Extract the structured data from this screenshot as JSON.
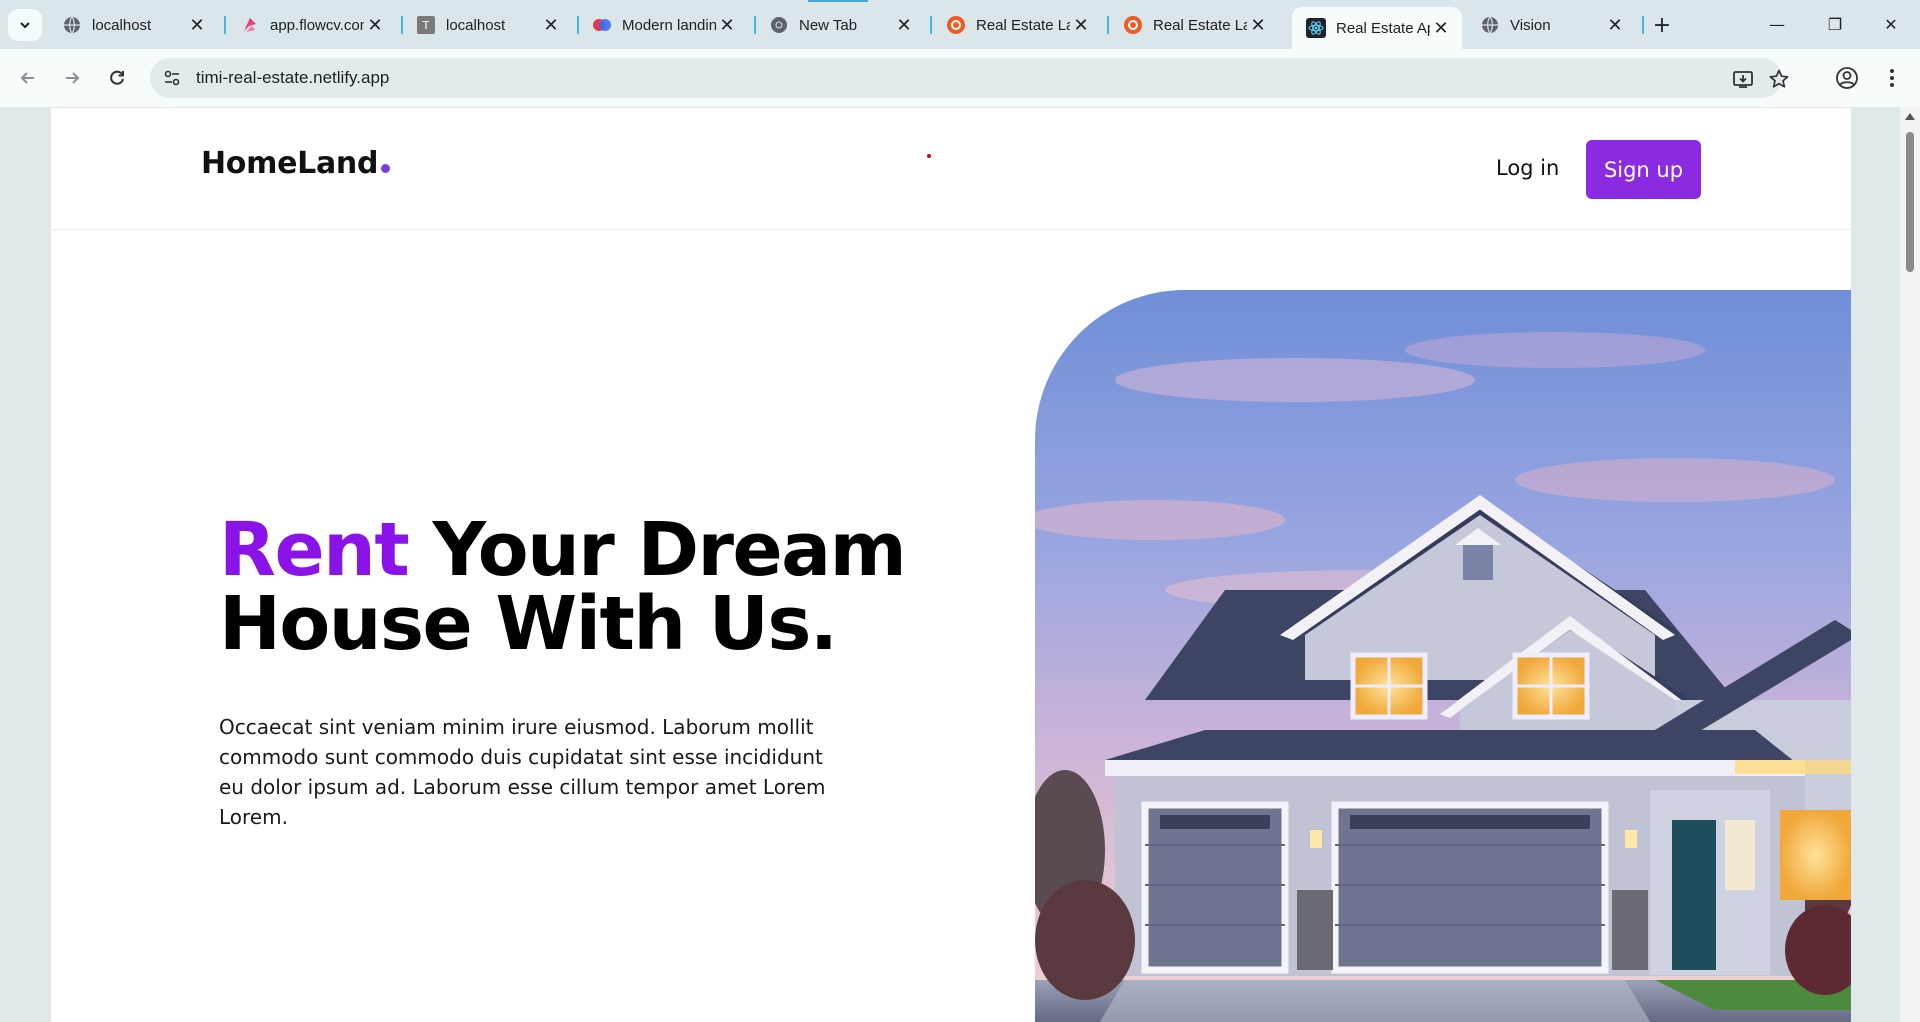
{
  "browser": {
    "tabs": [
      {
        "title": "localhost",
        "favicon": "globe-icon",
        "active": false
      },
      {
        "title": "app.flowcv.com",
        "favicon": "flowcv-icon",
        "active": false
      },
      {
        "title": "localhost",
        "favicon": "letter-t-icon",
        "active": false
      },
      {
        "title": "Modern landing",
        "favicon": "two-dots-icon",
        "active": false
      },
      {
        "title": "New Tab",
        "favicon": "chrome-icon",
        "active": false
      },
      {
        "title": "Real Estate La",
        "favicon": "brave-icon",
        "active": false
      },
      {
        "title": "Real Estate La",
        "favicon": "brave-icon",
        "active": false
      },
      {
        "title": "Real Estate Ap",
        "favicon": "react-icon",
        "active": true
      },
      {
        "title": "Vision",
        "favicon": "globe-icon",
        "active": false
      }
    ],
    "url": "timi-real-estate.netlify.app"
  },
  "site": {
    "logo": "HomeLand",
    "nav": {
      "login_label": "Log in",
      "signup_label": "Sign up"
    },
    "hero": {
      "title_accent": "Rent",
      "title_rest": " Your Dream House With Us.",
      "description": "Occaecat sint veniam minim irure eiusmod. Laborum mollit commodo sunt commodo duis cupidatat sint esse incididunt eu dolor ipsum ad. Laborum esse cillum tempor amet Lorem Lorem."
    }
  },
  "colors": {
    "accent": "#8a14e8",
    "signup_bg": "#8a2be2",
    "logo_dot": "#7b3fe4"
  }
}
